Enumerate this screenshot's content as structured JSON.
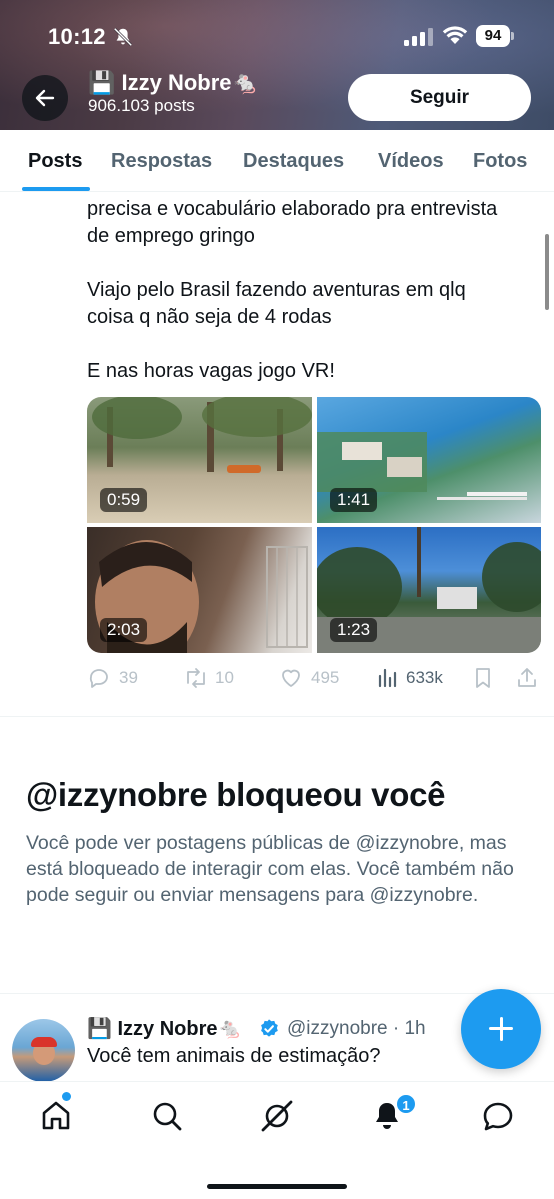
{
  "status_bar": {
    "time": "10:12",
    "battery": "94"
  },
  "header": {
    "name": "💾 Izzy Nobre🐁",
    "posts_count": "906.103 posts",
    "follow_label": "Seguir"
  },
  "tabs": [
    "Posts",
    "Respostas",
    "Destaques",
    "Vídeos",
    "Fotos"
  ],
  "post": {
    "lines": [
      "precisa e vocabulário elaborado pra entrevista",
      "de emprego gringo",
      "Viajo pelo Brasil fazendo aventuras em qlq",
      "coisa q não seja de 4 rodas",
      "E nas horas vagas jogo VR!"
    ],
    "media": [
      {
        "duration": "0:59"
      },
      {
        "duration": "1:41"
      },
      {
        "duration": "2:03"
      },
      {
        "duration": "1:23"
      }
    ],
    "stats": {
      "replies": "39",
      "reposts": "10",
      "likes": "495",
      "views": "633k"
    }
  },
  "blocked": {
    "title": "@izzynobre bloqueou você",
    "description": "Você pode ver postagens públicas de @izzynobre, mas está bloqueado de interagir com elas. Você também não pode seguir ou enviar mensagens para @izzynobre."
  },
  "next_post": {
    "name": "💾 Izzy Nobre🐁",
    "handle": "@izzynobre · 1h",
    "text": "Você tem animais de estimação?"
  },
  "bottom_nav": {
    "notifications_badge": "1"
  },
  "colors": {
    "accent": "#1d9bf0",
    "text": "#0f1419",
    "secondary": "#536471"
  },
  "icons": [
    "back-arrow-icon",
    "bell-off-icon",
    "signal-icon",
    "wifi-icon",
    "battery-icon",
    "reply-icon",
    "repost-icon",
    "like-icon",
    "views-icon",
    "bookmark-icon",
    "share-icon",
    "verified-icon",
    "compose-icon",
    "home-icon",
    "search-icon",
    "grok-icon",
    "bell-icon",
    "messages-icon"
  ]
}
